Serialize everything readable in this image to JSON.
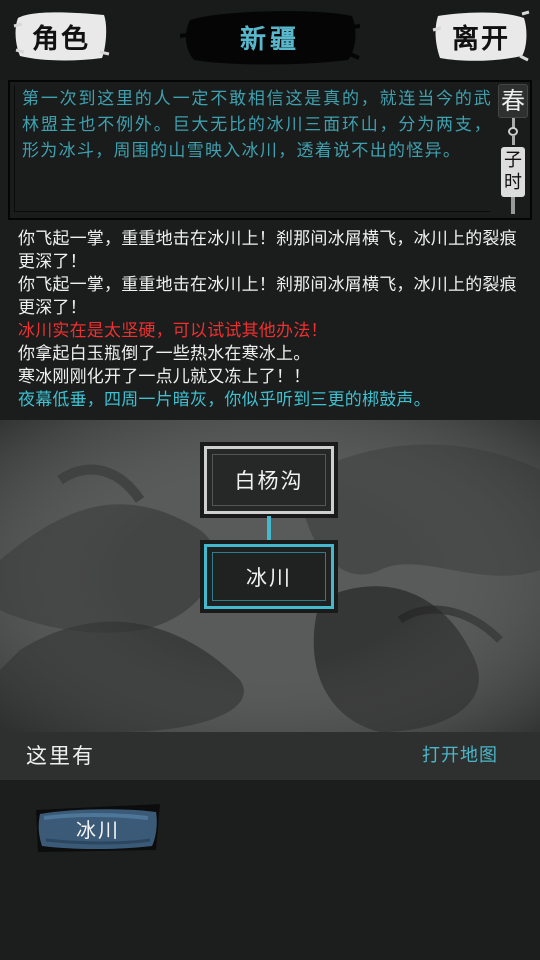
{
  "topbar": {
    "left_button": "角色",
    "title": "新疆",
    "right_button": "离开"
  },
  "description": {
    "text": "第一次到这里的人一定不敢相信这是真的，就连当今的武林盟主也不例外。巨大无比的冰川三面环山，分为两支，形为冰斗，周围的山雪映入冰川，透着说不出的怪异。",
    "season": "春",
    "time_char_1": "子",
    "time_char_2": "时"
  },
  "log": [
    {
      "text": "你飞起一掌，重重地击在冰川上！刹那间冰屑横飞，冰川上的裂痕更深了！",
      "color": "#f0f0f0"
    },
    {
      "text": "你飞起一掌，重重地击在冰川上！刹那间冰屑横飞，冰川上的裂痕更深了！",
      "color": "#f0f0f0"
    },
    {
      "text": "冰川实在是太坚硬，可以试试其他办法！",
      "color": "#ee3030"
    },
    {
      "text": "你拿起白玉瓶倒了一些热水在寒冰上。",
      "color": "#f0f0f0"
    },
    {
      "text": "寒冰刚刚化开了一点儿就又冻上了！！",
      "color": "#f0f0f0"
    },
    {
      "text": "夜幕低垂，四周一片暗灰，你似乎听到三更的梆鼓声。",
      "color": "#3ec0d0"
    }
  ],
  "map": {
    "north_node": "白杨沟",
    "current_node": "冰川"
  },
  "here": {
    "label": "这里有",
    "open_map": "打开地图",
    "items": [
      "冰川"
    ]
  },
  "colors": {
    "accent_cyan": "#44b8cc",
    "warning_red": "#ee3030",
    "description_teal": "#3fa1b0"
  }
}
